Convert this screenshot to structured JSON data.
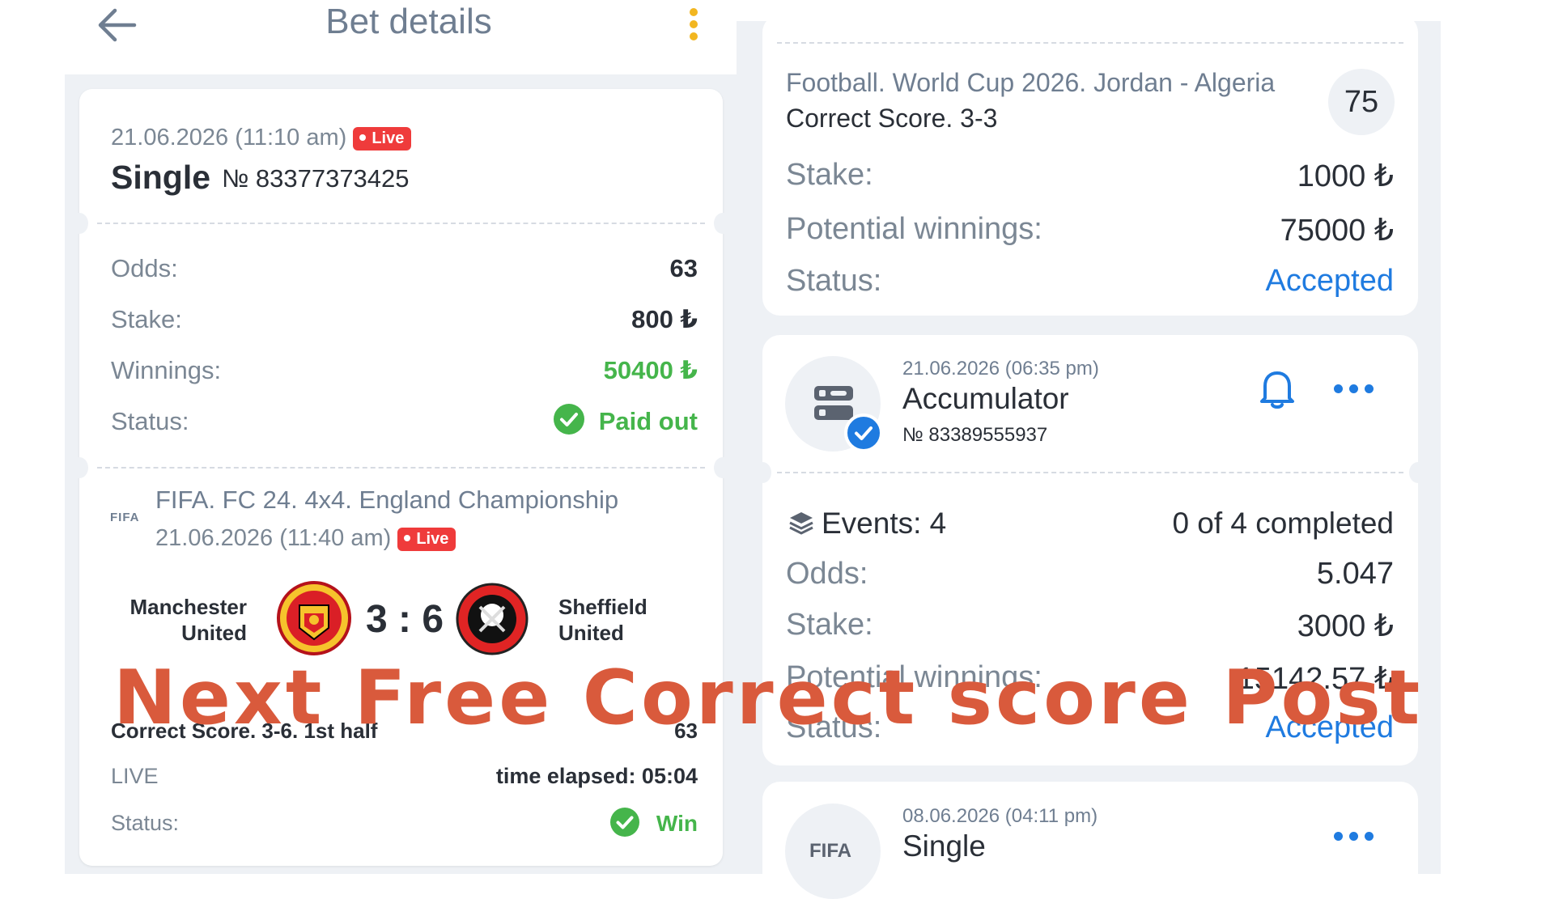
{
  "header": {
    "title": "Bet details"
  },
  "left_card": {
    "datetime": "21.06.2026 (11:10 am)",
    "live_label": "Live",
    "bet_type": "Single",
    "bet_number": "№ 83377373425",
    "rows": [
      {
        "label": "Odds:",
        "value": "63"
      },
      {
        "label": "Stake:",
        "value": "800 ₺"
      },
      {
        "label": "Winnings:",
        "value": "50400 ₺"
      },
      {
        "label": "Status:",
        "value": "Paid out"
      }
    ],
    "event": {
      "league_logo": "FIFA",
      "title": "FIFA. FC 24. 4x4. England Championship",
      "datetime": "21.06.2026 (11:40 am)",
      "live_label": "Live",
      "home_team": [
        "Manchester",
        "United"
      ],
      "away_team": [
        "Sheffield",
        "United"
      ],
      "score": "3 : 6",
      "market": "Correct Score. 3-6. 1st half",
      "market_odds": "63",
      "live_text": "LIVE",
      "time_elapsed": "time elapsed: 05:04",
      "status_label": "Status:",
      "status_value": "Win"
    }
  },
  "right_top_card": {
    "match": "Football. World Cup 2026. Jordan - Algeria",
    "market": "Correct Score. 3-3",
    "odds_badge": "75",
    "rows": [
      {
        "label": "Stake:",
        "value": "1000 ₺"
      },
      {
        "label": "Potential winnings:",
        "value": "75000 ₺"
      },
      {
        "label": "Status:",
        "value": "Accepted"
      }
    ]
  },
  "accumulator_card": {
    "datetime": "21.06.2026 (06:35 pm)",
    "bet_type": "Accumulator",
    "bet_number": "№ 83389555937",
    "events_label": "Events: 4",
    "completed": "0 of 4 completed",
    "rows": [
      {
        "label": "Odds:",
        "value": "5.047"
      },
      {
        "label": "Stake:",
        "value": "3000 ₺"
      },
      {
        "label": "Potential winnings:",
        "value": "15142.57 ₺"
      },
      {
        "label": "Status:",
        "value": "Accepted"
      }
    ]
  },
  "single_card": {
    "logo": "FIFA",
    "datetime": "08.06.2026 (04:11 pm)",
    "bet_type": "Single"
  },
  "overlay_text": "Next Free Correct score Post",
  "colors": {
    "green": "#45b54b",
    "blue": "#1f7be0",
    "live_red": "#ef3b3b",
    "overlay": "#d95a3c",
    "accent_yellow": "#f2b620"
  }
}
